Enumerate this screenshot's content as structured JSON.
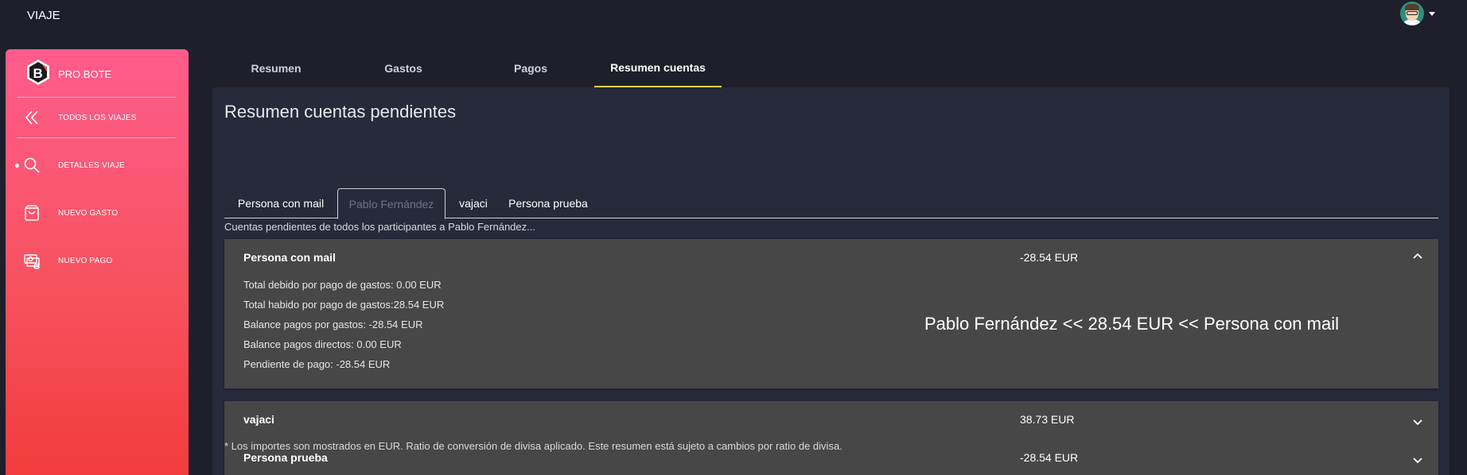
{
  "app": {
    "title": "VIAJE"
  },
  "user": {
    "avatar_icon": "user-avatar-icon"
  },
  "sidebar": {
    "brand": "PRO.BOTE",
    "items": [
      {
        "label": "TODOS LOS VIAJES",
        "icon": "chevrons-left-icon"
      },
      {
        "label": "DETALLES VIAJE",
        "icon": "search-icon",
        "active": true
      },
      {
        "label": "NUEVO GASTO",
        "icon": "shopping-bag-icon"
      },
      {
        "label": "NUEVO PAGO",
        "icon": "payment-icon"
      }
    ]
  },
  "main": {
    "tabs": [
      {
        "label": "Resumen"
      },
      {
        "label": "Gastos"
      },
      {
        "label": "Pagos"
      },
      {
        "label": "Resumen cuentas",
        "active": true
      }
    ],
    "page_title": "Resumen cuentas pendientes",
    "person_tabs": [
      {
        "label": "Persona con mail"
      },
      {
        "label": "Pablo Fernández",
        "active": true
      },
      {
        "label": "vajaci"
      },
      {
        "label": "Persona prueba"
      }
    ],
    "subtitle": "Cuentas pendientes de todos los participantes a Pablo Fernández...",
    "accounts": [
      {
        "name": "Persona con mail",
        "amount": "-28.54 EUR",
        "expanded": true,
        "details": [
          "Total debido por pago de gastos: 0.00 EUR",
          "Total habido por pago de gastos:28.54 EUR",
          "Balance pagos por gastos: -28.54 EUR",
          "Balance pagos directos: 0.00 EUR",
          "Pendiente de pago: -28.54 EUR"
        ],
        "settlement": "Pablo Fernández << 28.54 EUR << Persona con mail"
      },
      {
        "name": "vajaci",
        "amount": "38.73 EUR",
        "expanded": false
      },
      {
        "name": "Persona prueba",
        "amount": "-28.54 EUR",
        "expanded": false
      }
    ],
    "footnote": "* Los importes son mostrados en EUR. Ratio de conversión de divisa aplicado. Este resumen está sujeto a cambios por ratio de divisa."
  },
  "colors": {
    "background": "#1e1f2b",
    "panel": "#272a3b",
    "accordion": "#474747",
    "sidebar_top": "#ff5c8d",
    "sidebar_bottom": "#f23c3c",
    "active_tab_underline": "#f4d03f"
  }
}
